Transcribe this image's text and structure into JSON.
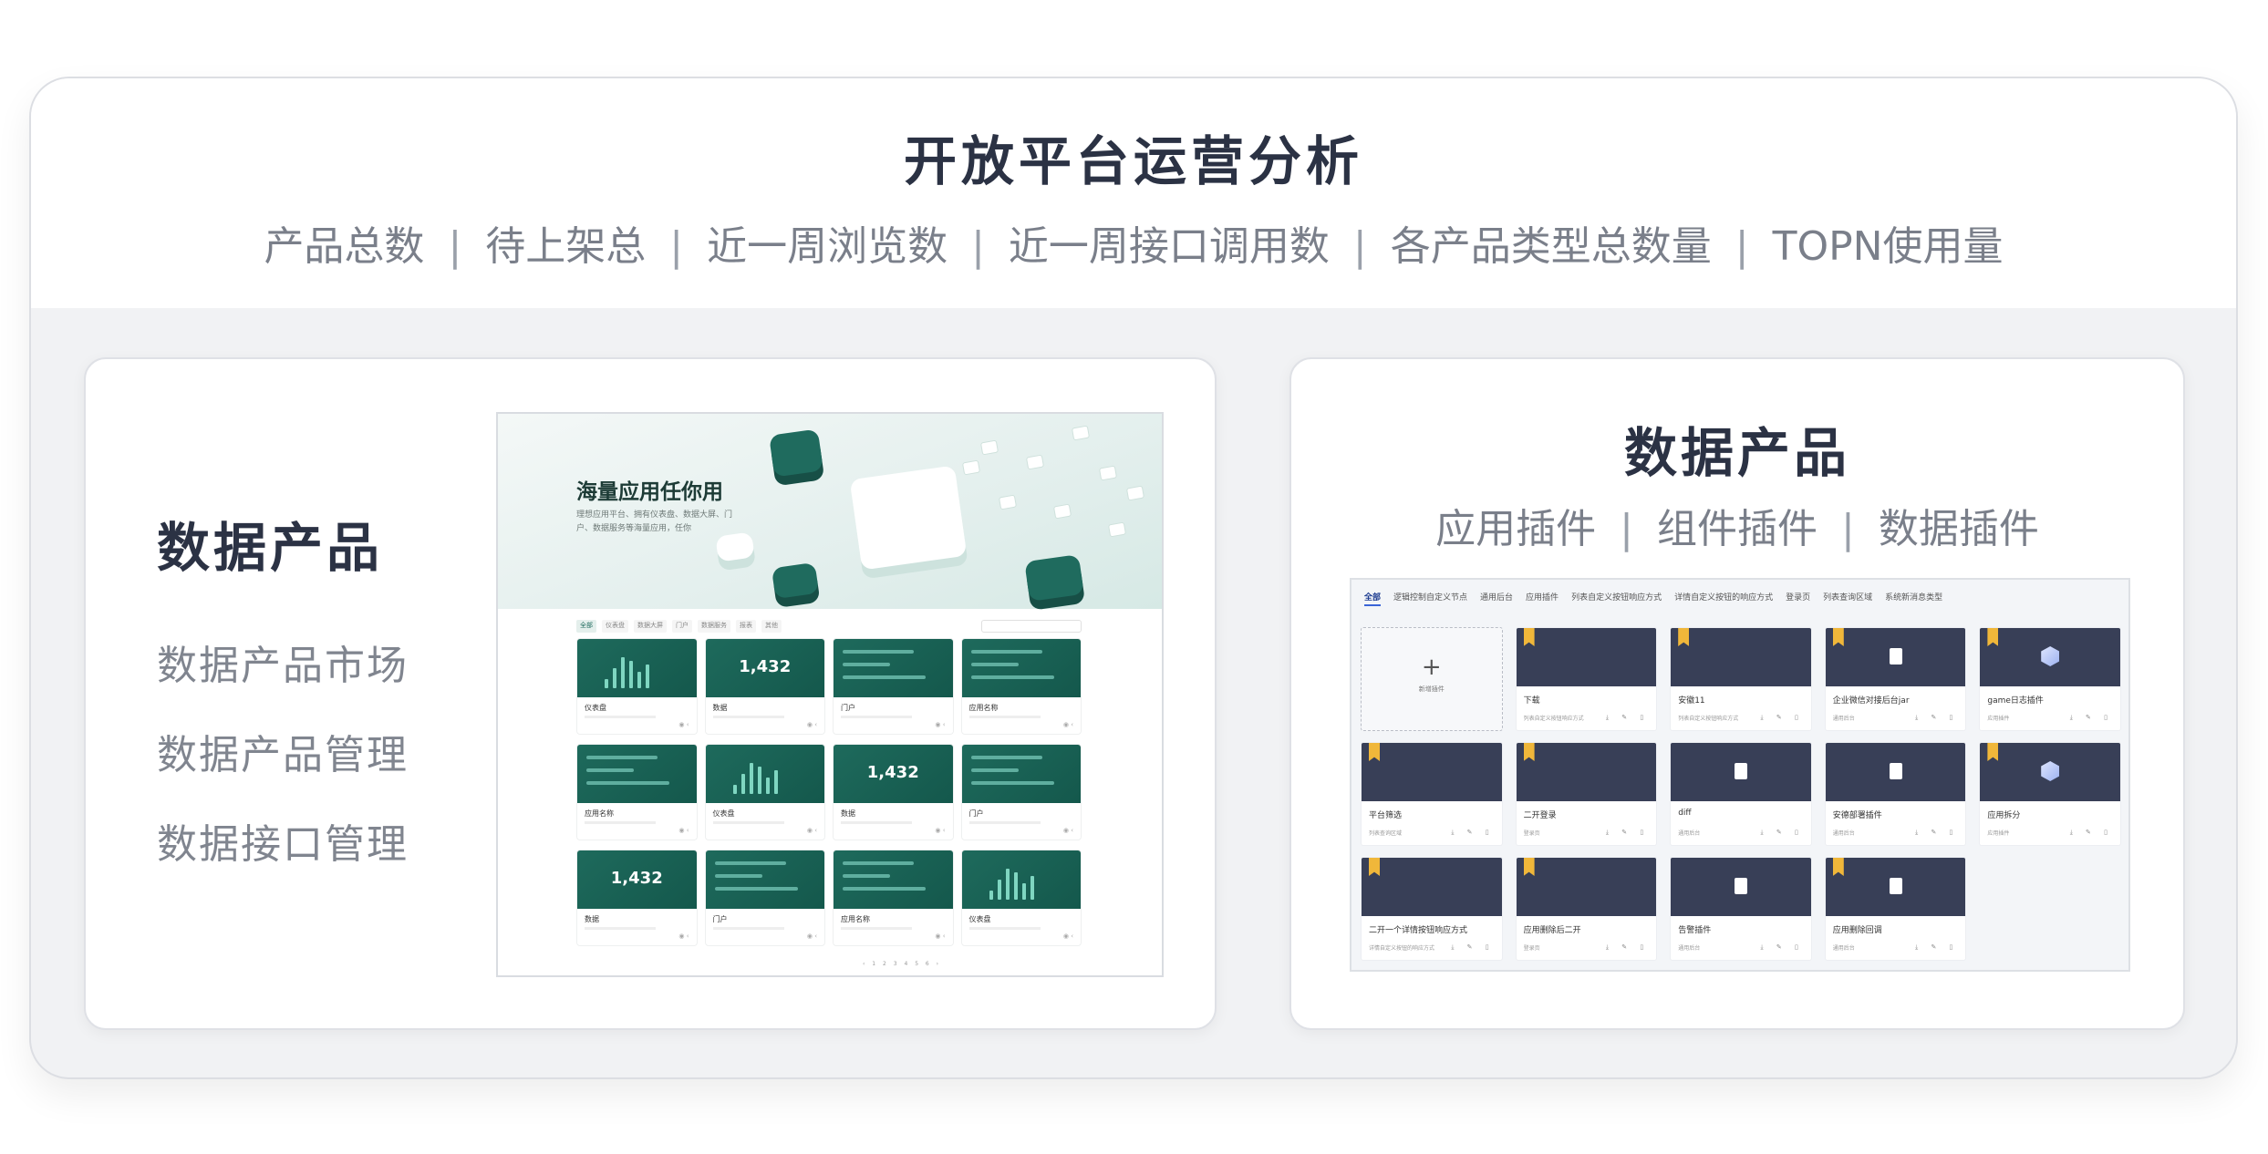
{
  "header": {
    "title": "开放平台运营分析",
    "metrics": [
      "产品总数",
      "待上架总",
      "近一周浏览数",
      "近一周接口调用数",
      "各产品类型总数量",
      "TOPN使用量"
    ],
    "separator": "|"
  },
  "left_panel": {
    "title": "数据产品",
    "items": [
      "数据产品市场",
      "数据产品管理",
      "数据接口管理"
    ],
    "screenshot": {
      "hero_title": "海量应用任你用",
      "hero_desc": "理想应用平台、拥有仪表盘、数据大屏、门户、数据服务等海量应用，任你",
      "filters": [
        "全部",
        "仪表盘",
        "数据大屏",
        "门户",
        "数据服务",
        "报表",
        "其他"
      ],
      "cards": [
        {
          "name": "仪表盘",
          "kind": "bars"
        },
        {
          "name": "数据",
          "kind": "num",
          "value": "1,432"
        },
        {
          "name": "门户",
          "kind": "lines"
        },
        {
          "name": "应用名称",
          "kind": "lines"
        },
        {
          "name": "应用名称",
          "kind": "lines"
        },
        {
          "name": "仪表盘",
          "kind": "bars"
        },
        {
          "name": "数据",
          "kind": "num",
          "value": "1,432"
        },
        {
          "name": "门户",
          "kind": "lines"
        },
        {
          "name": "数据",
          "kind": "num",
          "value": "1,432"
        },
        {
          "name": "门户",
          "kind": "lines"
        },
        {
          "name": "应用名称",
          "kind": "lines"
        },
        {
          "name": "仪表盘",
          "kind": "bars"
        }
      ]
    }
  },
  "right_panel": {
    "title": "数据产品",
    "subtitles": [
      "应用插件",
      "组件插件",
      "数据插件"
    ],
    "separator": "|",
    "screenshot": {
      "tabs": [
        "全部",
        "逻辑控制自定义节点",
        "通用后台",
        "应用插件",
        "列表自定义按钮响应方式",
        "详情自定义按钮的响应方式",
        "登录页",
        "列表查询区域",
        "系统新消息类型"
      ],
      "add_label": "新增插件",
      "cards": [
        {
          "name": "下载",
          "desc": "列表自定义按钮响应方式",
          "flag": true,
          "icon": "none"
        },
        {
          "name": "安徽11",
          "desc": "列表自定义按钮响应方式",
          "flag": true,
          "icon": "none"
        },
        {
          "name": "企业微信对接后台jar",
          "desc": "通用后台",
          "flag": true,
          "icon": "doc"
        },
        {
          "name": "game日志插件",
          "desc": "应用插件",
          "flag": true,
          "icon": "cube"
        },
        {
          "name": "平台筛选",
          "desc": "列表查询区域",
          "flag": true,
          "icon": "none"
        },
        {
          "name": "二开登录",
          "desc": "登录页",
          "flag": true,
          "icon": "none"
        },
        {
          "name": "diff",
          "desc": "通用后台",
          "flag": false,
          "icon": "doc"
        },
        {
          "name": "安德部署插件",
          "desc": "通用后台",
          "flag": false,
          "icon": "doc"
        },
        {
          "name": "应用拆分",
          "desc": "应用插件",
          "flag": true,
          "icon": "cube"
        },
        {
          "name": "二开一个详情按钮响应方式",
          "desc": "详情自定义按钮的响应方式",
          "flag": true,
          "icon": "none"
        },
        {
          "name": "应用删除后二开",
          "desc": "登录页",
          "flag": true,
          "icon": "none"
        },
        {
          "name": "告警插件",
          "desc": "通用后台",
          "flag": false,
          "icon": "doc"
        },
        {
          "name": "应用删除回调",
          "desc": "通用后台",
          "flag": true,
          "icon": "doc"
        }
      ]
    }
  },
  "colors": {
    "accent_green": "#1f6b5e",
    "accent_navy": "#383f57",
    "flag": "#f0b73a",
    "title": "#2b3244",
    "muted": "#7a7f8a"
  }
}
